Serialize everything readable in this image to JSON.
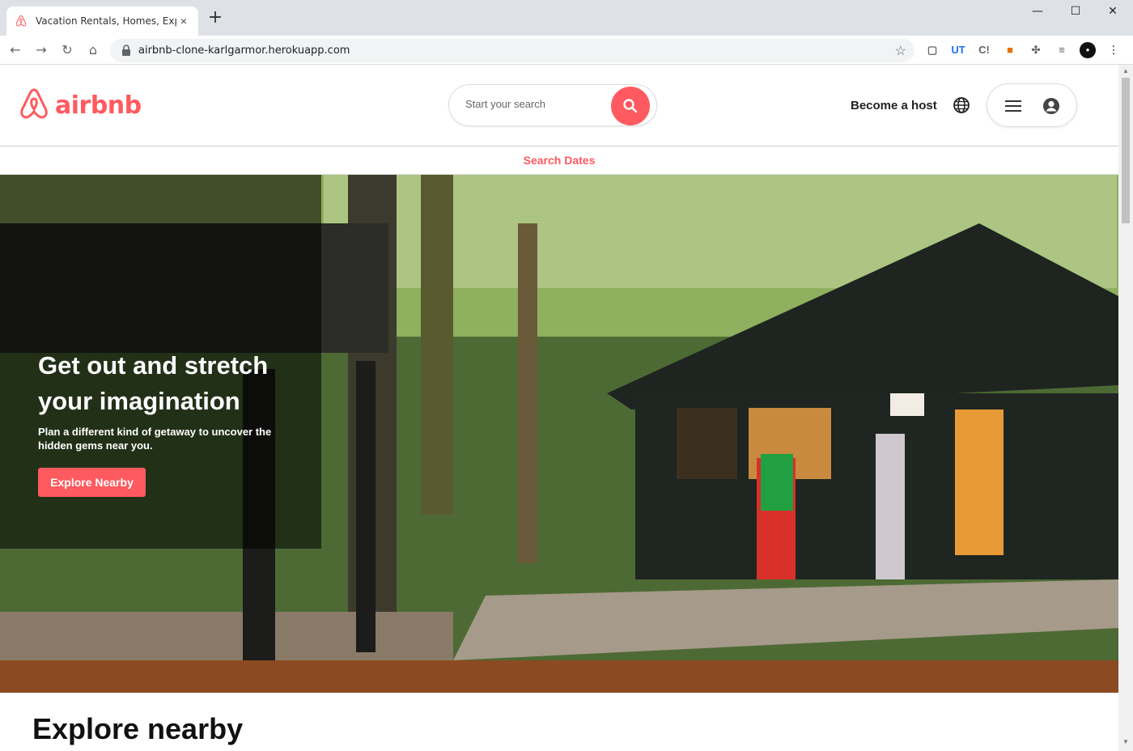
{
  "browser": {
    "tab_title": "Vacation Rentals, Homes, Experie",
    "tab_close": "×",
    "new_tab": "+",
    "url": "airbnb-clone-karlgarmor.herokuapp.com",
    "window": {
      "minimize": "—",
      "maximize": "☐",
      "close": "✕"
    },
    "extensions": [
      "UT",
      "C!"
    ]
  },
  "header": {
    "logo_text": "airbnb",
    "brand_color": "#ff5a5f",
    "search": {
      "placeholder": "Start your search"
    },
    "host_label": "Become a host"
  },
  "dates_bar": {
    "label": "Search Dates"
  },
  "hero": {
    "title": "Get out and stretch your imagination",
    "subtitle": "Plan a different kind of getaway to uncover the hidden gems near you.",
    "button": "Explore Nearby"
  },
  "section": {
    "title": "Explore nearby"
  }
}
